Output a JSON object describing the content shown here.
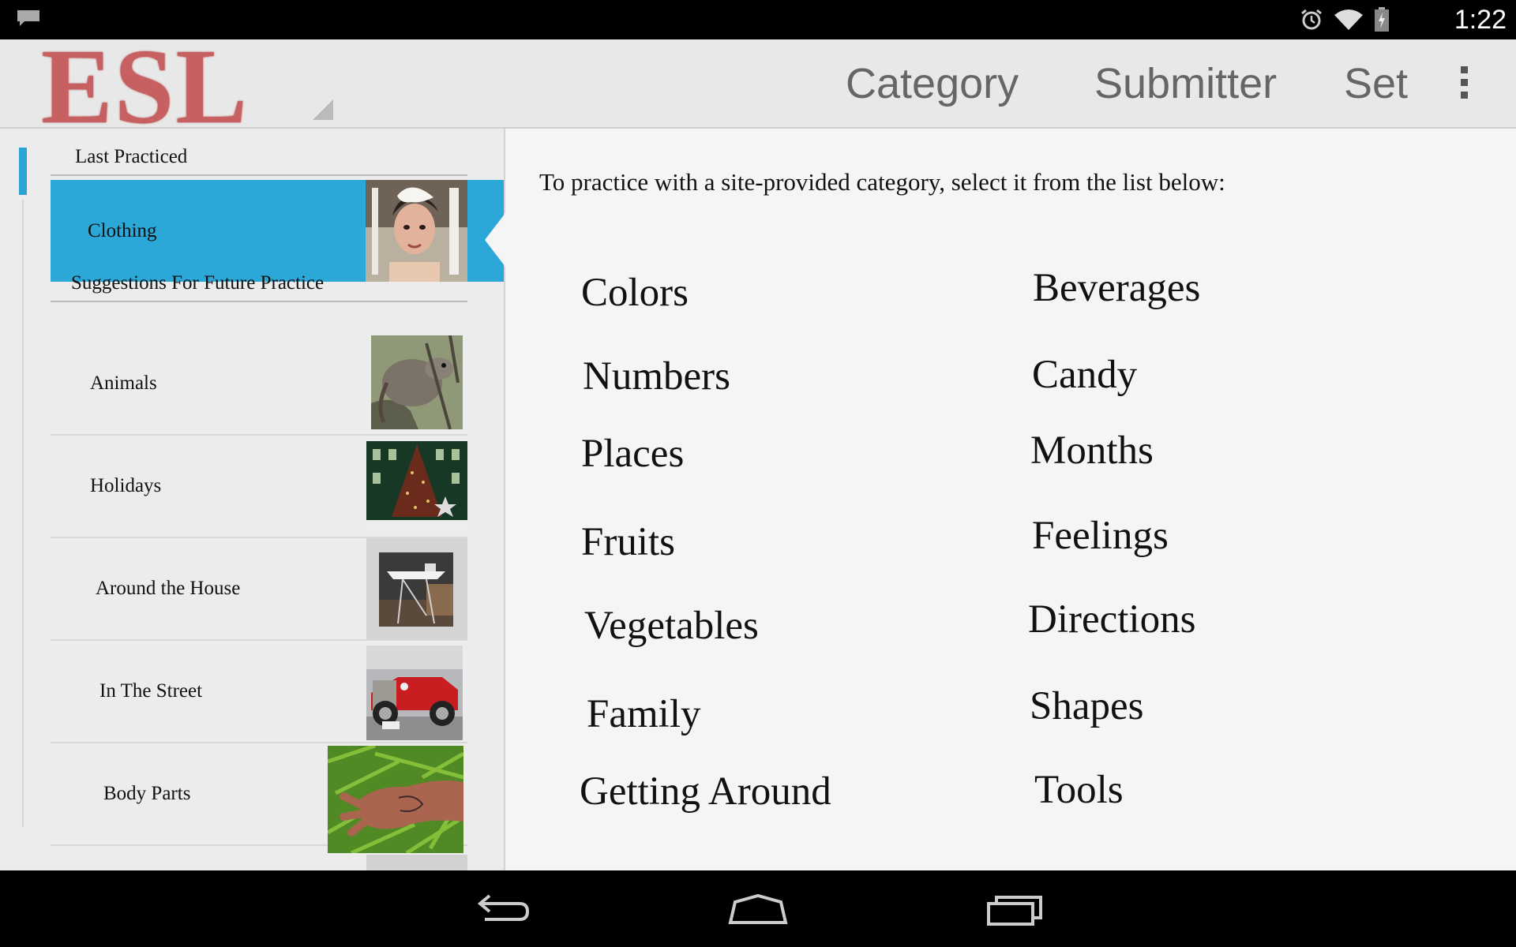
{
  "status_bar": {
    "time": "1:22",
    "icons": [
      "notification-icon",
      "alarm-icon",
      "wifi-icon",
      "battery-icon"
    ]
  },
  "action_bar": {
    "logo": "ESL",
    "nav": [
      "Category",
      "Submitter",
      "Set"
    ],
    "overflow_icon": "overflow-menu-icon"
  },
  "sidebar": {
    "last_practiced_header": "Last Practiced",
    "last_practiced_item": "Clothing",
    "suggestions_header": "Suggestions For Future Practice",
    "suggestions": [
      "Animals",
      "Holidays",
      "Around the House",
      "In The Street",
      "Body Parts"
    ]
  },
  "main": {
    "intro": "To practice with a site-provided category, select it from the list below:",
    "categories_left": [
      "Colors",
      "Numbers",
      "Places",
      "Fruits",
      "Vegetables",
      "Family",
      "Getting Around"
    ],
    "categories_right": [
      "Beverages",
      "Candy",
      "Months",
      "Feelings",
      "Directions",
      "Shapes",
      "Tools"
    ]
  },
  "nav_bar": {
    "icons": [
      "back-icon",
      "home-icon",
      "recent-apps-icon"
    ]
  },
  "colors": {
    "accent": "#2ba7d8",
    "logo": "#c76161"
  }
}
